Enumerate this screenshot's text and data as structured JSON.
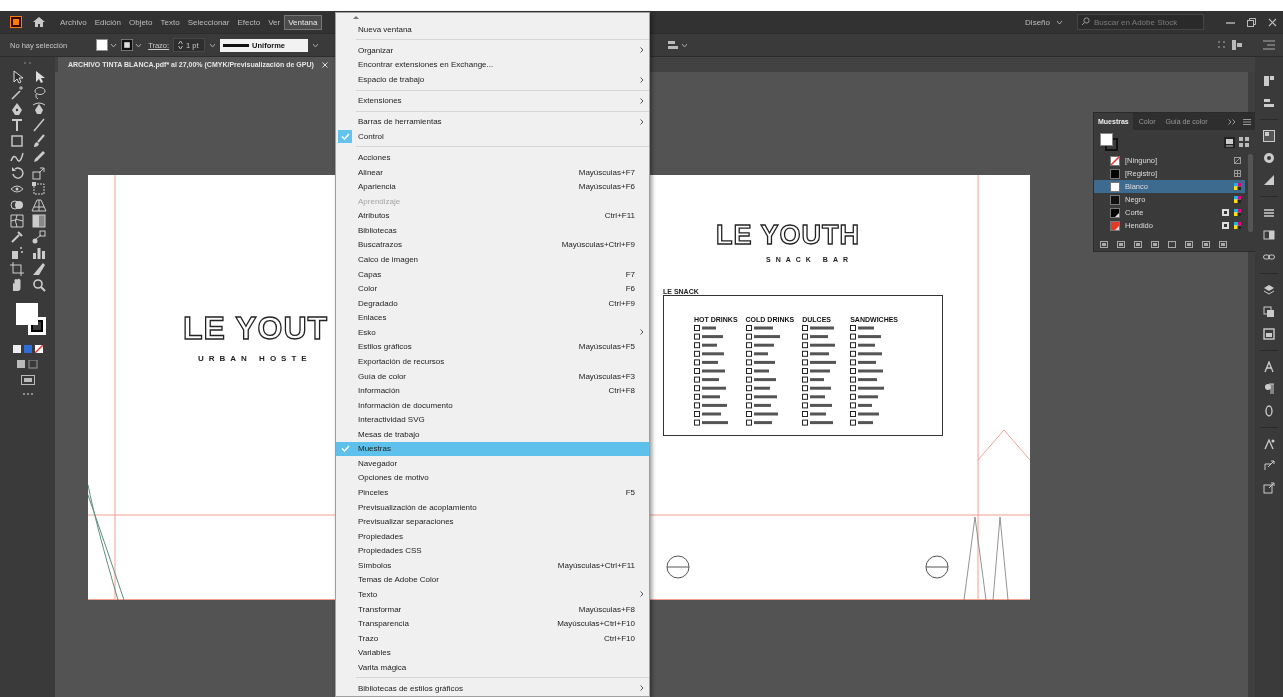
{
  "menubar": {
    "items": [
      {
        "label": "Archivo",
        "selected": false
      },
      {
        "label": "Edición",
        "selected": false
      },
      {
        "label": "Objeto",
        "selected": false
      },
      {
        "label": "Texto",
        "selected": false
      },
      {
        "label": "Seleccionar",
        "selected": false
      },
      {
        "label": "Efecto",
        "selected": false
      },
      {
        "label": "Ver",
        "selected": false
      },
      {
        "label": "Ventana",
        "selected": true
      }
    ],
    "workspace": "Diseño",
    "search": {
      "placeholder": "Buscar en Adobe Stock"
    }
  },
  "control_bar": {
    "selection": "No hay selección",
    "stroke_label": "Trazo:",
    "stroke_weight": "1 pt",
    "profile": "Uniforme"
  },
  "document_tab": {
    "title": "ARCHIVO TINTA BLANCA.pdf* al 27,00% (CMYK/Previsualización de GPU)"
  },
  "artboard": {
    "hostel_logo": {
      "title": "LE YOUT",
      "subtitle": "URBAN HOSTE"
    },
    "snack_logo": {
      "title": "LE YOUTH",
      "subtitle": "SNACK BAR"
    },
    "snack_menu": {
      "title": "LE SNACK",
      "columns": [
        "HOT DRINKS",
        "COLD DRINKS",
        "DULCES",
        "SANDWICHES"
      ]
    }
  },
  "swatches_panel": {
    "tabs": [
      {
        "label": "Muestras",
        "selected": true
      },
      {
        "label": "Color",
        "selected": false
      },
      {
        "label": "Guía de color",
        "selected": false
      }
    ],
    "swatches": [
      {
        "name": "[Ninguno]",
        "kind": "none",
        "color": "#ffffff",
        "selected": false
      },
      {
        "name": "[Registro]",
        "kind": "registration",
        "color": "#000000",
        "selected": false
      },
      {
        "name": "Blanco",
        "kind": "process",
        "color": "#ffffff",
        "selected": true
      },
      {
        "name": "Negro",
        "kind": "process",
        "color": "#111111",
        "selected": false
      },
      {
        "name": "Corte",
        "kind": "spot",
        "color": "#000000",
        "selected": false
      },
      {
        "name": "Hendido",
        "kind": "spot",
        "color": "#e5392a",
        "selected": false
      }
    ]
  },
  "window_menu": {
    "groups": [
      {
        "items": [
          {
            "label": "Nueva ventana",
            "submenu": false,
            "checked": false,
            "disabled": false,
            "selected": false
          }
        ]
      },
      {
        "items": [
          {
            "label": "Organizar",
            "submenu": true,
            "checked": false,
            "disabled": false,
            "selected": false
          },
          {
            "label": "Encontrar extensiones en Exchange...",
            "submenu": false,
            "checked": false,
            "disabled": false,
            "selected": false
          },
          {
            "label": "Espacio de trabajo",
            "submenu": true,
            "checked": false,
            "disabled": false,
            "selected": false
          }
        ]
      },
      {
        "items": [
          {
            "label": "Extensiones",
            "submenu": true,
            "checked": false,
            "disabled": false,
            "selected": false
          }
        ]
      },
      {
        "items": [
          {
            "label": "Barras de herramientas",
            "submenu": true,
            "checked": false,
            "disabled": false,
            "selected": false
          },
          {
            "label": "Control",
            "submenu": false,
            "checked": true,
            "disabled": false,
            "selected": false
          }
        ]
      },
      {
        "items": [
          {
            "label": "Acciones",
            "submenu": false,
            "checked": false,
            "disabled": false,
            "selected": false
          },
          {
            "label": "Alinear",
            "shortcut": "Mayúsculas+F7",
            "submenu": false,
            "checked": false,
            "disabled": false,
            "selected": false
          },
          {
            "label": "Apariencia",
            "shortcut": "Mayúsculas+F6",
            "submenu": false,
            "checked": false,
            "disabled": false,
            "selected": false
          },
          {
            "label": "Aprendizaje",
            "submenu": false,
            "checked": false,
            "disabled": true,
            "selected": false
          },
          {
            "label": "Atributos",
            "shortcut": "Ctrl+F11",
            "submenu": false,
            "checked": false,
            "disabled": false,
            "selected": false
          },
          {
            "label": "Bibliotecas",
            "submenu": false,
            "checked": false,
            "disabled": false,
            "selected": false
          },
          {
            "label": "Buscatrazos",
            "shortcut": "Mayúsculas+Ctrl+F9",
            "submenu": false,
            "checked": false,
            "disabled": false,
            "selected": false
          },
          {
            "label": "Calco de imagen",
            "submenu": false,
            "checked": false,
            "disabled": false,
            "selected": false
          },
          {
            "label": "Capas",
            "shortcut": "F7",
            "submenu": false,
            "checked": false,
            "disabled": false,
            "selected": false
          },
          {
            "label": "Color",
            "shortcut": "F6",
            "submenu": false,
            "checked": false,
            "disabled": false,
            "selected": false
          },
          {
            "label": "Degradado",
            "shortcut": "Ctrl+F9",
            "submenu": false,
            "checked": false,
            "disabled": false,
            "selected": false
          },
          {
            "label": "Enlaces",
            "submenu": false,
            "checked": false,
            "disabled": false,
            "selected": false
          },
          {
            "label": "Esko",
            "submenu": true,
            "checked": false,
            "disabled": false,
            "selected": false
          },
          {
            "label": "Estilos gráficos",
            "shortcut": "Mayúsculas+F5",
            "submenu": false,
            "checked": false,
            "disabled": false,
            "selected": false
          },
          {
            "label": "Exportación de recursos",
            "submenu": false,
            "checked": false,
            "disabled": false,
            "selected": false
          },
          {
            "label": "Guía de color",
            "shortcut": "Mayúsculas+F3",
            "submenu": false,
            "checked": false,
            "disabled": false,
            "selected": false
          },
          {
            "label": "Información",
            "shortcut": "Ctrl+F8",
            "submenu": false,
            "checked": false,
            "disabled": false,
            "selected": false
          },
          {
            "label": "Información de documento",
            "submenu": false,
            "checked": false,
            "disabled": false,
            "selected": false
          },
          {
            "label": "Interactividad SVG",
            "submenu": false,
            "checked": false,
            "disabled": false,
            "selected": false
          },
          {
            "label": "Mesas de trabajo",
            "submenu": false,
            "checked": false,
            "disabled": false,
            "selected": false
          },
          {
            "label": "Muestras",
            "submenu": false,
            "checked": true,
            "disabled": false,
            "selected": true
          },
          {
            "label": "Navegador",
            "submenu": false,
            "checked": false,
            "disabled": false,
            "selected": false
          },
          {
            "label": "Opciones de motivo",
            "submenu": false,
            "checked": false,
            "disabled": false,
            "selected": false
          },
          {
            "label": "Pinceles",
            "shortcut": "F5",
            "submenu": false,
            "checked": false,
            "disabled": false,
            "selected": false
          },
          {
            "label": "Previsualización de acoplamiento",
            "submenu": false,
            "checked": false,
            "disabled": false,
            "selected": false
          },
          {
            "label": "Previsualizar separaciones",
            "submenu": false,
            "checked": false,
            "disabled": false,
            "selected": false
          },
          {
            "label": "Propiedades",
            "submenu": false,
            "checked": false,
            "disabled": false,
            "selected": false
          },
          {
            "label": "Propiedades CSS",
            "submenu": false,
            "checked": false,
            "disabled": false,
            "selected": false
          },
          {
            "label": "Símbolos",
            "shortcut": "Mayúsculas+Ctrl+F11",
            "submenu": false,
            "checked": false,
            "disabled": false,
            "selected": false
          },
          {
            "label": "Temas de Adobe Color",
            "submenu": false,
            "checked": false,
            "disabled": false,
            "selected": false
          },
          {
            "label": "Texto",
            "submenu": true,
            "checked": false,
            "disabled": false,
            "selected": false
          },
          {
            "label": "Transformar",
            "shortcut": "Mayúsculas+F8",
            "submenu": false,
            "checked": false,
            "disabled": false,
            "selected": false
          },
          {
            "label": "Transparencia",
            "shortcut": "Mayúsculas+Ctrl+F10",
            "submenu": false,
            "checked": false,
            "disabled": false,
            "selected": false
          },
          {
            "label": "Trazo",
            "shortcut": "Ctrl+F10",
            "submenu": false,
            "checked": false,
            "disabled": false,
            "selected": false
          },
          {
            "label": "Variables",
            "submenu": false,
            "checked": false,
            "disabled": false,
            "selected": false
          },
          {
            "label": "Varita mágica",
            "submenu": false,
            "checked": false,
            "disabled": false,
            "selected": false
          }
        ]
      },
      {
        "items": [
          {
            "label": "Bibliotecas de estilos gráficos",
            "submenu": true,
            "checked": false,
            "disabled": false,
            "selected": false
          }
        ]
      }
    ]
  }
}
